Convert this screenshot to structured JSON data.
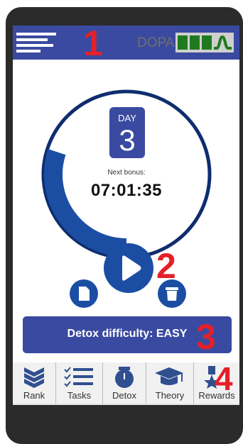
{
  "header": {
    "brand": "DOPA"
  },
  "steps": {
    "s1": "1",
    "s2": "2",
    "s3": "3",
    "s4": "4"
  },
  "timer": {
    "day_label": "DAY",
    "day_number": "3",
    "next_bonus_label": "Next bonus:",
    "countdown": "07:01:35",
    "ring_progress": 0.3
  },
  "difficulty": {
    "label": "Detox difficulty: EASY"
  },
  "tabs": [
    {
      "label": "Rank",
      "icon": "rank-chevrons-icon"
    },
    {
      "label": "Tasks",
      "icon": "checklist-icon"
    },
    {
      "label": "Detox",
      "icon": "detox-icon"
    },
    {
      "label": "Theory",
      "icon": "graduation-cap-icon"
    },
    {
      "label": "Rewards",
      "icon": "medal-star-icon"
    }
  ],
  "colors": {
    "accent": "#3a4aa0",
    "button_blue": "#1b4ea3",
    "ring_dark": "#0f2d6e",
    "step_red": "#e4202a",
    "logo_green": "#1f7a1f"
  }
}
